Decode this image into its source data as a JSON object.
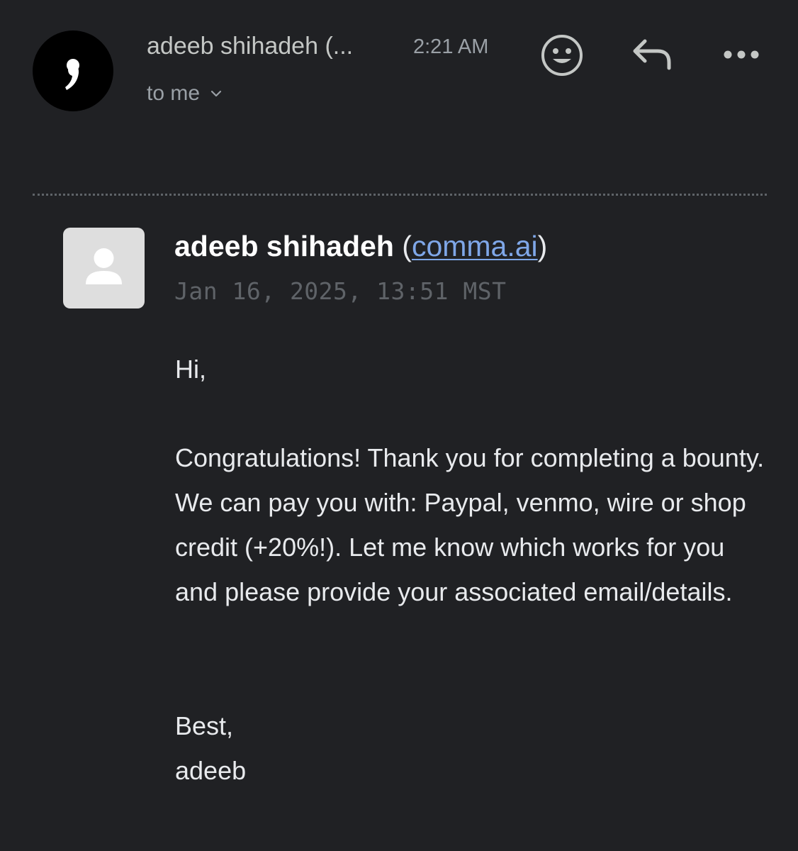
{
  "header": {
    "sender_short": "adeeb shihadeh (...",
    "time": "2:21 AM",
    "recipient": "to me",
    "icons": {
      "sender_logo": "comma-logo-icon",
      "emoji": "smiley-icon",
      "reply": "reply-icon",
      "more": "more-horizontal-icon",
      "expand": "chevron-down-icon"
    }
  },
  "message": {
    "from_name": "adeeb shihadeh",
    "paren_open": "(",
    "from_domain": "comma.ai",
    "paren_close": ")",
    "date": "Jan 16, 2025, 13:51 MST",
    "avatar_icon": "person-icon",
    "greeting": "Hi,",
    "body": "Congratulations! Thank you for completing a bounty. We can pay you with: Paypal, venmo, wire or shop credit (+20%!). Let me know which works for you and please provide your associated email/details.",
    "signoff": "Best,",
    "signature": "adeeb"
  },
  "colors": {
    "background": "#202124",
    "link": "#7fa7e8",
    "muted": "#9aa0a6",
    "text": "#e8eaed"
  }
}
